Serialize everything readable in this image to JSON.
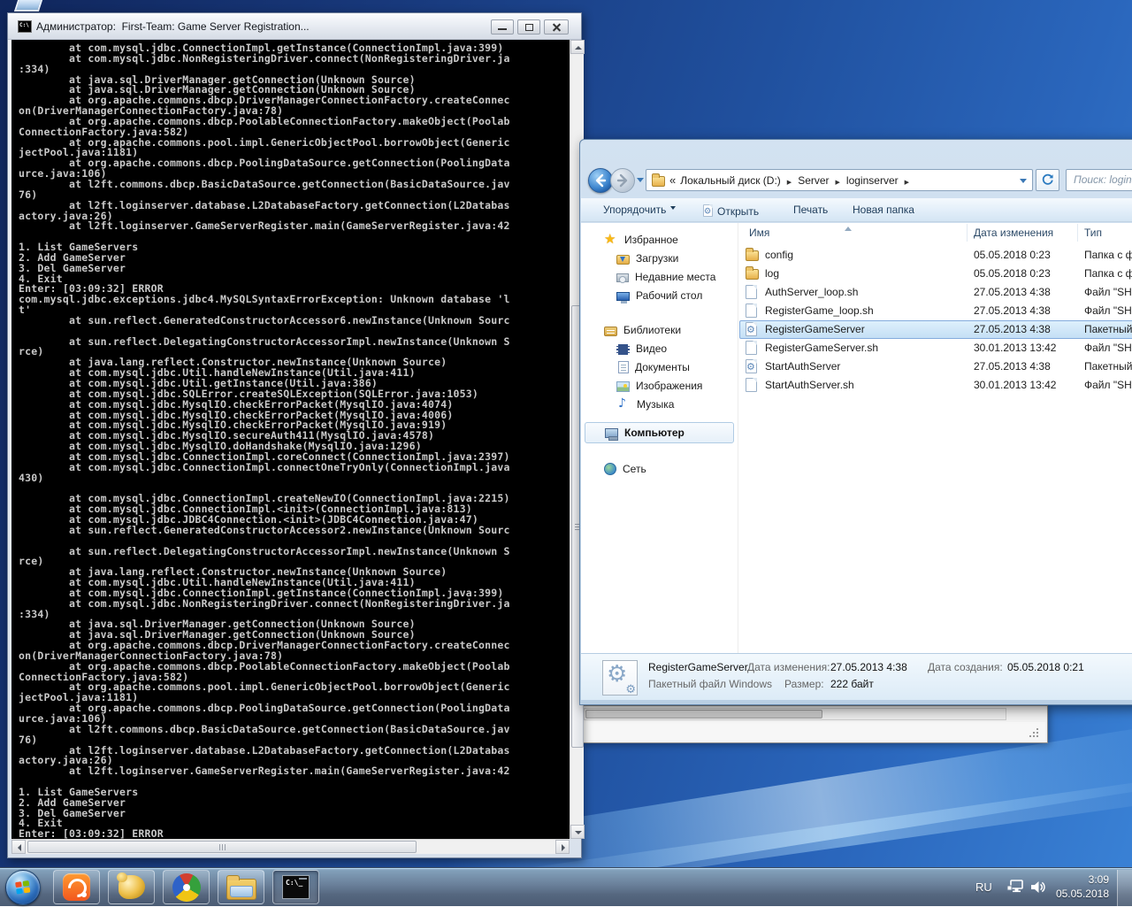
{
  "console": {
    "title": "Администратор:  First-Team: Game Server Registration...",
    "lines": [
      "        at com.mysql.jdbc.ConnectionImpl.getInstance(ConnectionImpl.java:399)",
      "        at com.mysql.jdbc.NonRegisteringDriver.connect(NonRegisteringDriver.ja",
      ":334)",
      "        at java.sql.DriverManager.getConnection(Unknown Source)",
      "        at java.sql.DriverManager.getConnection(Unknown Source)",
      "        at org.apache.commons.dbcp.DriverManagerConnectionFactory.createConnec",
      "on(DriverManagerConnectionFactory.java:78)",
      "        at org.apache.commons.dbcp.PoolableConnectionFactory.makeObject(Poolab",
      "ConnectionFactory.java:582)",
      "        at org.apache.commons.pool.impl.GenericObjectPool.borrowObject(Generic",
      "jectPool.java:1181)",
      "        at org.apache.commons.dbcp.PoolingDataSource.getConnection(PoolingData",
      "urce.java:106)",
      "        at l2ft.commons.dbcp.BasicDataSource.getConnection(BasicDataSource.jav",
      "76)",
      "        at l2ft.loginserver.database.L2DatabaseFactory.getConnection(L2Databas",
      "actory.java:26)",
      "        at l2ft.loginserver.GameServerRegister.main(GameServerRegister.java:42",
      "",
      "1. List GameServers",
      "2. Add GameServer",
      "3. Del GameServer",
      "4. Exit",
      "Enter: [03:09:32] ERROR",
      "com.mysql.jdbc.exceptions.jdbc4.MySQLSyntaxErrorException: Unknown database 'l",
      "t'",
      "        at sun.reflect.GeneratedConstructorAccessor6.newInstance(Unknown Sourc",
      "",
      "        at sun.reflect.DelegatingConstructorAccessorImpl.newInstance(Unknown S",
      "rce)",
      "        at java.lang.reflect.Constructor.newInstance(Unknown Source)",
      "        at com.mysql.jdbc.Util.handleNewInstance(Util.java:411)",
      "        at com.mysql.jdbc.Util.getInstance(Util.java:386)",
      "        at com.mysql.jdbc.SQLError.createSQLException(SQLError.java:1053)",
      "        at com.mysql.jdbc.MysqlIO.checkErrorPacket(MysqlIO.java:4074)",
      "        at com.mysql.jdbc.MysqlIO.checkErrorPacket(MysqlIO.java:4006)",
      "        at com.mysql.jdbc.MysqlIO.checkErrorPacket(MysqlIO.java:919)",
      "        at com.mysql.jdbc.MysqlIO.secureAuth411(MysqlIO.java:4578)",
      "        at com.mysql.jdbc.MysqlIO.doHandshake(MysqlIO.java:1296)",
      "        at com.mysql.jdbc.ConnectionImpl.coreConnect(ConnectionImpl.java:2397)",
      "        at com.mysql.jdbc.ConnectionImpl.connectOneTryOnly(ConnectionImpl.java",
      "430)",
      "",
      "        at com.mysql.jdbc.ConnectionImpl.createNewIO(ConnectionImpl.java:2215)",
      "        at com.mysql.jdbc.ConnectionImpl.<init>(ConnectionImpl.java:813)",
      "        at com.mysql.jdbc.JDBC4Connection.<init>(JDBC4Connection.java:47)",
      "        at sun.reflect.GeneratedConstructorAccessor2.newInstance(Unknown Sourc",
      "",
      "        at sun.reflect.DelegatingConstructorAccessorImpl.newInstance(Unknown S",
      "rce)",
      "        at java.lang.reflect.Constructor.newInstance(Unknown Source)",
      "        at com.mysql.jdbc.Util.handleNewInstance(Util.java:411)",
      "        at com.mysql.jdbc.ConnectionImpl.getInstance(ConnectionImpl.java:399)",
      "        at com.mysql.jdbc.NonRegisteringDriver.connect(NonRegisteringDriver.ja",
      ":334)",
      "        at java.sql.DriverManager.getConnection(Unknown Source)",
      "        at java.sql.DriverManager.getConnection(Unknown Source)",
      "        at org.apache.commons.dbcp.DriverManagerConnectionFactory.createConnec",
      "on(DriverManagerConnectionFactory.java:78)",
      "        at org.apache.commons.dbcp.PoolableConnectionFactory.makeObject(Poolab",
      "ConnectionFactory.java:582)",
      "        at org.apache.commons.pool.impl.GenericObjectPool.borrowObject(Generic",
      "jectPool.java:1181)",
      "        at org.apache.commons.dbcp.PoolingDataSource.getConnection(PoolingData",
      "urce.java:106)",
      "        at l2ft.commons.dbcp.BasicDataSource.getConnection(BasicDataSource.jav",
      "76)",
      "        at l2ft.loginserver.database.L2DatabaseFactory.getConnection(L2Databas",
      "actory.java:26)",
      "        at l2ft.loginserver.GameServerRegister.main(GameServerRegister.java:42",
      "",
      "1. List GameServers",
      "2. Add GameServer",
      "3. Del GameServer",
      "4. Exit",
      "Enter: [03:09:32] ERROR"
    ]
  },
  "explorer": {
    "address": {
      "prefix": "«",
      "crumbs": [
        "Локальный диск (D:)",
        "Server",
        "loginserver"
      ]
    },
    "search_text": "Поиск: logins",
    "toolbar": {
      "organize": "Упорядочить",
      "open": "Открыть",
      "print": "Печать",
      "new_folder": "Новая папка"
    },
    "sidebar": {
      "sections": [
        {
          "label": "Избранное",
          "icon": "star",
          "children": [
            {
              "label": "Загрузки",
              "icon": "downloads"
            },
            {
              "label": "Недавние места",
              "icon": "recent"
            },
            {
              "label": "Рабочий стол",
              "icon": "desktopi"
            }
          ]
        },
        {
          "label": "Библиотеки",
          "icon": "libraries",
          "children": [
            {
              "label": "Видео",
              "icon": "video"
            },
            {
              "label": "Документы",
              "icon": "docs"
            },
            {
              "label": "Изображения",
              "icon": "pictures"
            },
            {
              "label": "Музыка",
              "icon": "music"
            }
          ]
        },
        {
          "label": "Компьютер",
          "icon": "computer",
          "selected": true,
          "children": []
        },
        {
          "label": "Сеть",
          "icon": "network",
          "children": []
        }
      ]
    },
    "columns": [
      "Имя",
      "Дата изменения",
      "Тип"
    ],
    "files": [
      {
        "name": "config",
        "date": "05.05.2018 0:23",
        "type": "Папка с файлами",
        "icon": "folder",
        "selected": false
      },
      {
        "name": "log",
        "date": "05.05.2018 0:23",
        "type": "Папка с файлами",
        "icon": "folder",
        "selected": false
      },
      {
        "name": "AuthServer_loop.sh",
        "date": "27.05.2013 4:38",
        "type": "Файл \"SH\"",
        "icon": "file",
        "selected": false
      },
      {
        "name": "RegisterGame_loop.sh",
        "date": "27.05.2013 4:38",
        "type": "Файл \"SH\"",
        "icon": "file",
        "selected": false
      },
      {
        "name": "RegisterGameServer",
        "date": "27.05.2013 4:38",
        "type": "Пакетный ф",
        "icon": "batch",
        "selected": true
      },
      {
        "name": "RegisterGameServer.sh",
        "date": "30.01.2013 13:42",
        "type": "Файл \"SH\"",
        "icon": "file",
        "selected": false
      },
      {
        "name": "StartAuthServer",
        "date": "27.05.2013 4:38",
        "type": "Пакетный ф",
        "icon": "batch",
        "selected": false
      },
      {
        "name": "StartAuthServer.sh",
        "date": "30.01.2013 13:42",
        "type": "Файл \"SH\"",
        "icon": "file",
        "selected": false
      }
    ],
    "details": {
      "name": "RegisterGameServer",
      "type": "Пакетный файл Windows",
      "modified_label": "Дата изменения:",
      "modified_value": "27.05.2013 4:38",
      "size_label": "Размер:",
      "size_value": "222 байт",
      "created_label": "Дата создания:",
      "created_value": "05.05.2018 0:21"
    }
  },
  "taskbar": {
    "tray": {
      "lang": "RU",
      "time": "3:09",
      "date": "05.05.2018"
    }
  }
}
